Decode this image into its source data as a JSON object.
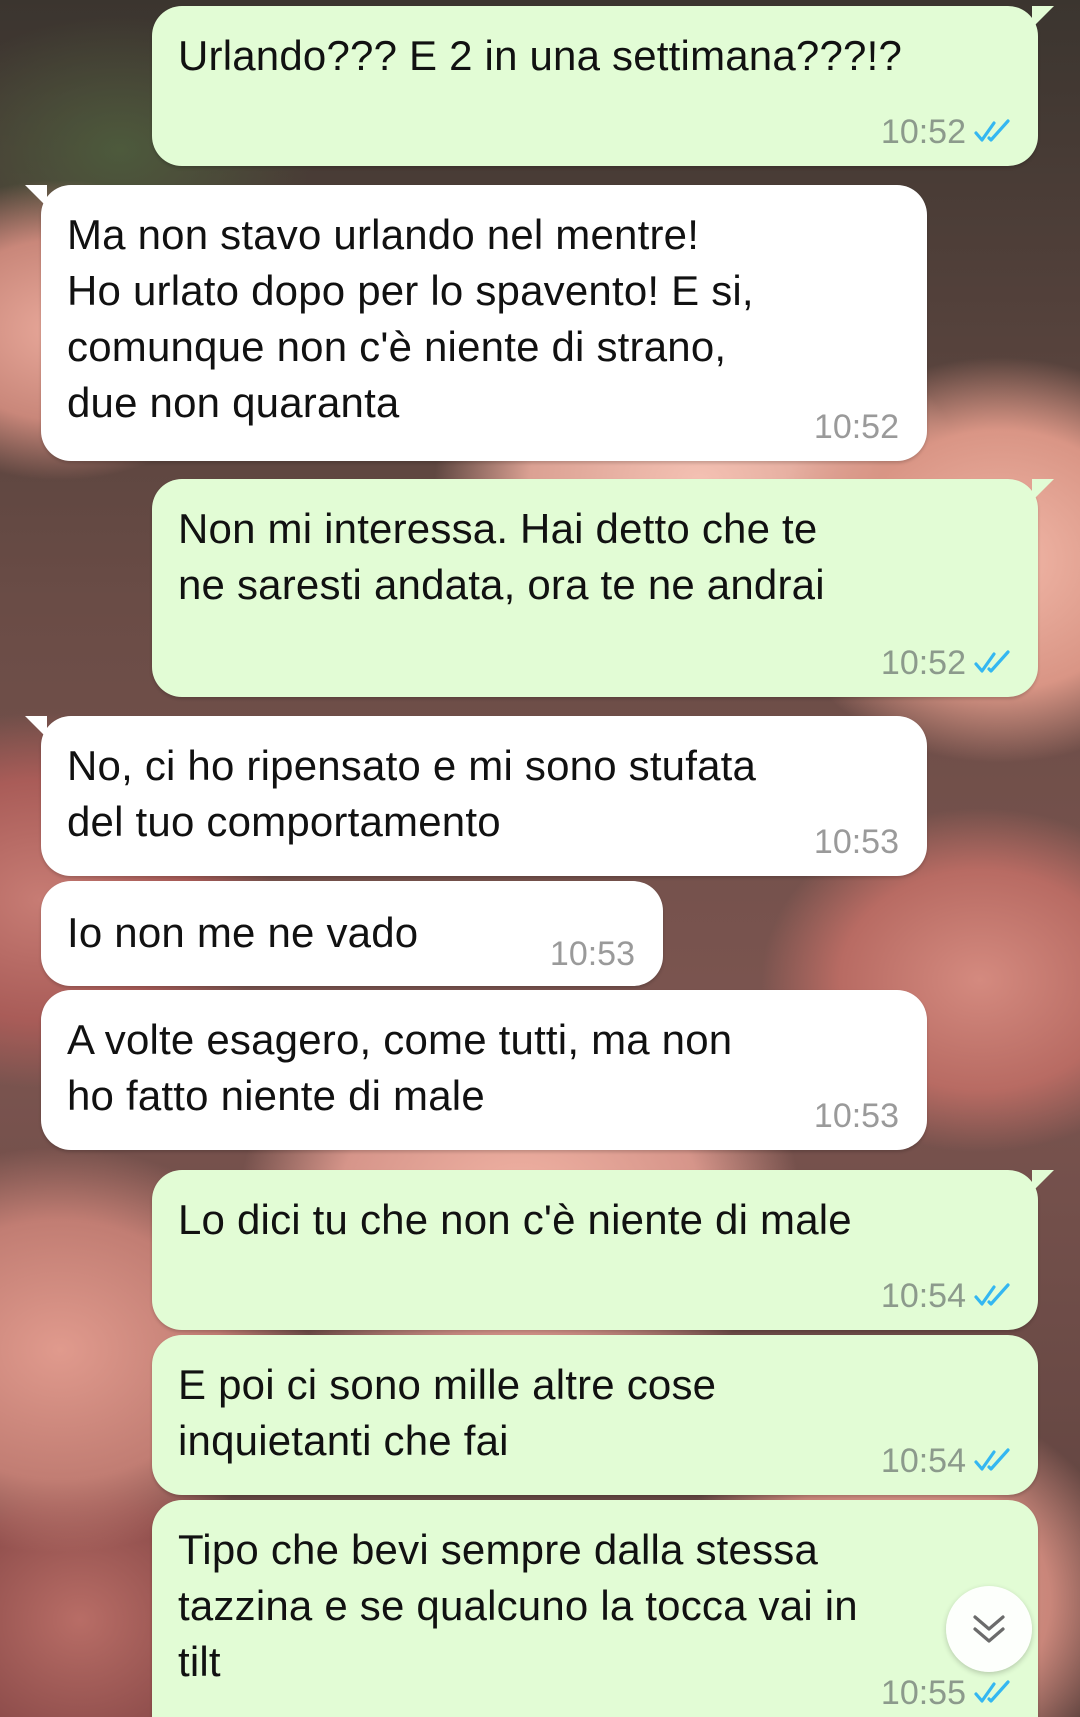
{
  "messages": [
    {
      "dir": "out",
      "lines": [
        "Urlando??? E 2 in una settimana???!?"
      ],
      "time": "10:52",
      "read": true
    },
    {
      "dir": "in",
      "lines": [
        "Ma non stavo urlando nel mentre!",
        "Ho urlato dopo per lo spavento! E si,",
        "comunque non c'è niente di strano,",
        "due non quaranta"
      ],
      "time": "10:52"
    },
    {
      "dir": "out",
      "lines": [
        "Non mi interessa. Hai detto che te",
        "ne saresti andata, ora te ne andrai"
      ],
      "time": "10:52",
      "read": true
    },
    {
      "dir": "in",
      "lines": [
        "No, ci ho ripensato e mi sono stufata",
        "del tuo comportamento"
      ],
      "time": "10:53"
    },
    {
      "dir": "in",
      "lines": [
        "Io non me ne vado"
      ],
      "time": "10:53"
    },
    {
      "dir": "in",
      "lines": [
        "A volte esagero, come tutti, ma non",
        "ho fatto niente di male"
      ],
      "time": "10:53"
    },
    {
      "dir": "out",
      "lines": [
        "Lo dici tu che non c'è niente di male"
      ],
      "time": "10:54",
      "read": true
    },
    {
      "dir": "out",
      "lines": [
        "E poi ci sono mille altre cose",
        "inquietanti che fai"
      ],
      "time": "10:54",
      "read": true
    },
    {
      "dir": "out",
      "lines": [
        "Tipo che bevi sempre dalla stessa",
        "tazzina e se qualcuno la tocca vai in",
        "tilt"
      ],
      "time": "10:55",
      "read": true
    }
  ],
  "icons": {
    "read_receipt": "double-check-icon",
    "scroll_down": "chevron-double-down-icon"
  },
  "colors": {
    "outgoing_bubble": "#e2fcd5",
    "incoming_bubble": "#ffffff",
    "read_tick": "#34b7f1"
  }
}
